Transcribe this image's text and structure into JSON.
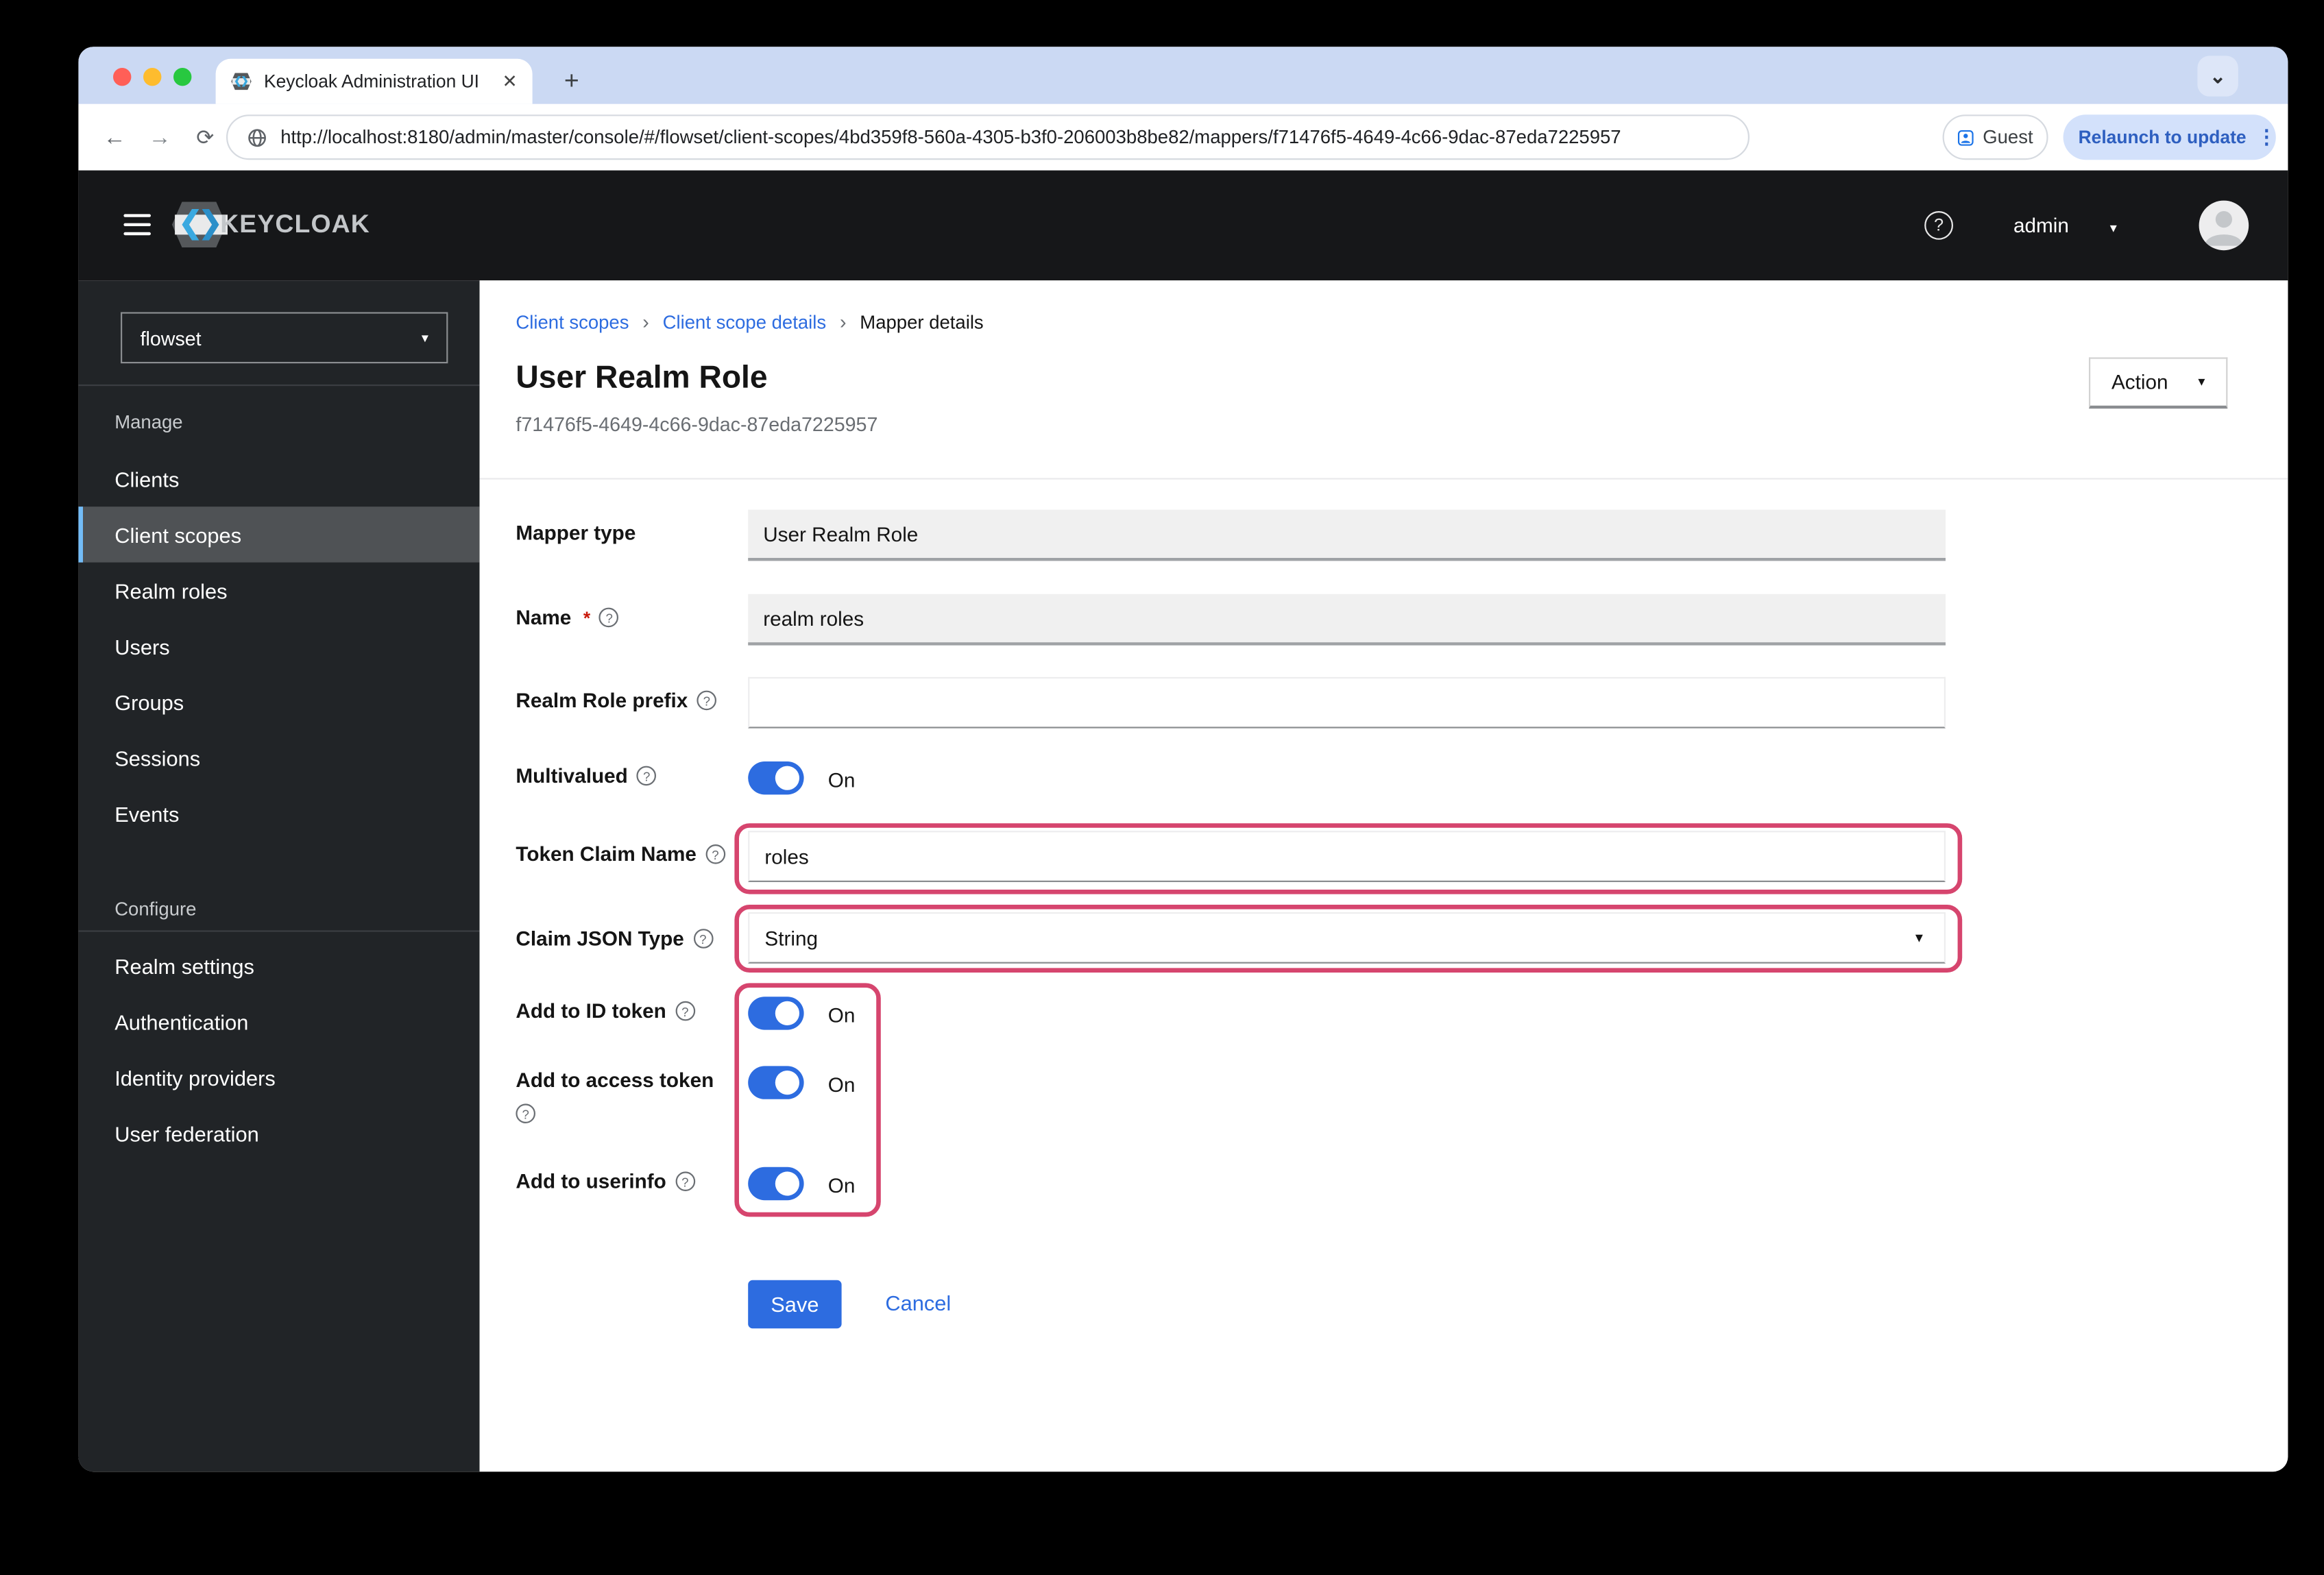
{
  "browser": {
    "tab_title": "Keycloak Administration UI",
    "url": "http://localhost:8180/admin/master/console/#/flowset/client-scopes/4bd359f8-560a-4305-b3f0-206003b8be82/mappers/f71476f5-4649-4c66-9dac-87eda7225957",
    "guest_label": "Guest",
    "relaunch_label": "Relaunch to update"
  },
  "masthead": {
    "brand": "KEYCLOAK",
    "username": "admin"
  },
  "sidebar": {
    "realm": "flowset",
    "manage_label": "Manage",
    "manage_items": [
      "Clients",
      "Client scopes",
      "Realm roles",
      "Users",
      "Groups",
      "Sessions",
      "Events"
    ],
    "active_item": "Client scopes",
    "configure_label": "Configure",
    "configure_items": [
      "Realm settings",
      "Authentication",
      "Identity providers",
      "User federation"
    ]
  },
  "page": {
    "breadcrumb": [
      "Client scopes",
      "Client scope details",
      "Mapper details"
    ],
    "title": "User Realm Role",
    "subtitle": "f71476f5-4649-4c66-9dac-87eda7225957",
    "action_label": "Action",
    "save_label": "Save",
    "cancel_label": "Cancel"
  },
  "form": {
    "mapper_type": {
      "label": "Mapper type",
      "value": "User Realm Role"
    },
    "name": {
      "label": "Name",
      "required": "*",
      "value": "realm roles"
    },
    "realm_role_prefix": {
      "label": "Realm Role prefix",
      "value": ""
    },
    "multivalued": {
      "label": "Multivalued",
      "state": "On"
    },
    "token_claim_name": {
      "label": "Token Claim Name",
      "value": "roles"
    },
    "claim_json_type": {
      "label": "Claim JSON Type",
      "value": "String"
    },
    "add_to_id_token": {
      "label": "Add to ID token",
      "state": "On"
    },
    "add_to_access_token": {
      "label": "Add to access token",
      "state": "On"
    },
    "add_to_userinfo": {
      "label": "Add to userinfo",
      "state": "On"
    }
  },
  "icons": {
    "close": "✕",
    "plus": "+",
    "back": "←",
    "forward": "→",
    "reload": "⟳",
    "chevron_down": "⌄",
    "caret_down": "▾",
    "kebab": "⋮",
    "help": "?",
    "breadcrumb_sep": "›"
  },
  "colors": {
    "primary_blue": "#2d6ce0",
    "link_blue": "#2d6ce0",
    "annotation_pink": "#d6456e",
    "masthead_bg": "#161719",
    "sidebar_bg": "#212427",
    "active_nav_bg": "#4f5255",
    "active_nav_border": "#73bcf7",
    "tabstrip_bg": "#cbd9f3",
    "relaunch_bg": "#d3e1fb"
  }
}
